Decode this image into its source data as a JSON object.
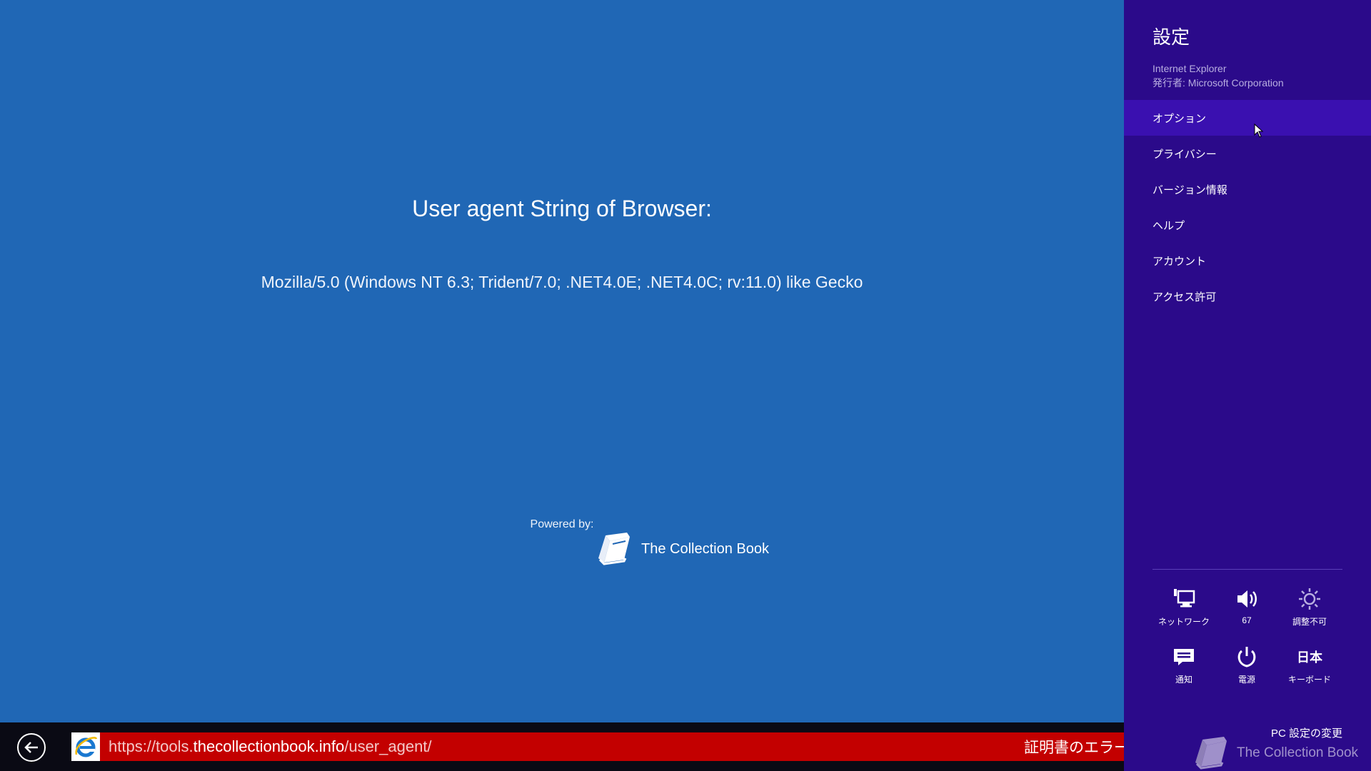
{
  "page": {
    "title": "User agent String of Browser:",
    "user_agent": "Mozilla/5.0 (Windows NT 6.3; Trident/7.0; .NET4.0E; .NET4.0C; rv:11.0) like Gecko",
    "powered_label": "Powered by:",
    "brand_name": "The Collection Book"
  },
  "address_bar": {
    "url_prefix": "https://tools.",
    "url_host": "thecollectionbook.info",
    "url_path": "/user_agent/",
    "cert_warning": "証明書のエラー"
  },
  "charm": {
    "title": "設定",
    "app_name": "Internet Explorer",
    "publisher": "発行者: Microsoft Corporation",
    "menu": [
      {
        "label": "オプション"
      },
      {
        "label": "プライバシー"
      },
      {
        "label": "バージョン情報"
      },
      {
        "label": "ヘルプ"
      },
      {
        "label": "アカウント"
      },
      {
        "label": "アクセス許可"
      }
    ],
    "quick_settings": [
      {
        "label": "ネットワーク",
        "icon": "network-icon"
      },
      {
        "label": "67",
        "icon": "volume-icon"
      },
      {
        "label": "調整不可",
        "icon": "brightness-icon"
      },
      {
        "label": "通知",
        "icon": "notifications-icon"
      },
      {
        "label": "電源",
        "icon": "power-icon"
      },
      {
        "label": "キーボード",
        "icon_text": "日本"
      }
    ],
    "pc_settings": "PC 設定の変更",
    "brand_name": "The Collection Book"
  },
  "colors": {
    "page_bg": "#2067b5",
    "charm_bg": "#2b0a8a",
    "address_bg": "#c30000"
  }
}
